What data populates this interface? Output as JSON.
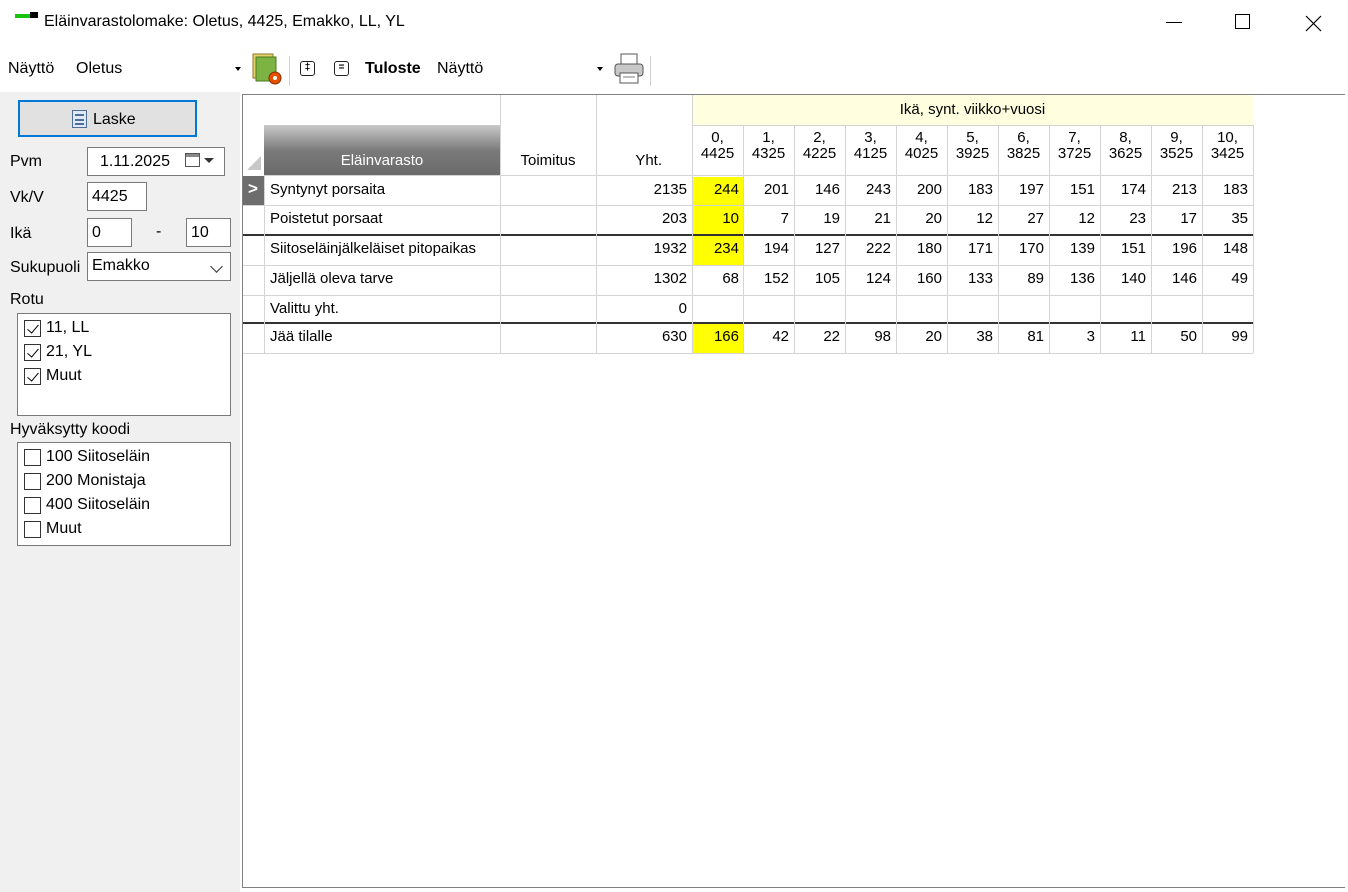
{
  "window": {
    "title": "Eläinvarastolomake: Oletus, 4425, Emakko, LL, YL"
  },
  "toolbar": {
    "display_label": "Näyttö",
    "display_value": "Oletus",
    "print_label": "Tuloste",
    "print_value": "Näyttö",
    "expand_symbol": "‡",
    "collapse_symbol": "="
  },
  "left": {
    "calc_button": "Laske",
    "date_label": "Pvm",
    "date_value": "1.11.2025",
    "week_label": "Vk/V",
    "week_value": "4425",
    "age_label": "Ikä",
    "age_from": "0",
    "age_dash": "-",
    "age_to": "10",
    "sex_label": "Sukupuoli",
    "sex_value": "Emakko",
    "breed_label": "Rotu",
    "breeds": [
      {
        "label": "11, LL",
        "checked": true
      },
      {
        "label": "21, YL",
        "checked": true
      },
      {
        "label": "Muut",
        "checked": true
      }
    ],
    "code_label": "Hyväksytty koodi",
    "codes": [
      {
        "label": "100 Siitoseläin",
        "checked": false
      },
      {
        "label": "200 Monistaja",
        "checked": false
      },
      {
        "label": "400 Siitoseläin",
        "checked": false
      },
      {
        "label": "Muut",
        "checked": false
      }
    ]
  },
  "grid": {
    "group_header": "Ikä, synt. viikko+vuosi",
    "col_elain": "Eläinvarasto",
    "col_toimitus": "Toimitus",
    "col_yht": "Yht.",
    "age_cols": [
      {
        "a": "0,",
        "b": "4425"
      },
      {
        "a": "1,",
        "b": "4325"
      },
      {
        "a": "2,",
        "b": "4225"
      },
      {
        "a": "3,",
        "b": "4125"
      },
      {
        "a": "4,",
        "b": "4025"
      },
      {
        "a": "5,",
        "b": "3925"
      },
      {
        "a": "6,",
        "b": "3825"
      },
      {
        "a": "7,",
        "b": "3725"
      },
      {
        "a": "8,",
        "b": "3625"
      },
      {
        "a": "9,",
        "b": "3525"
      },
      {
        "a": "10,",
        "b": "3425"
      }
    ],
    "current_row_marker": ">",
    "highlight_color": "#ffff00",
    "rows": [
      {
        "label": "Syntynyt porsaita",
        "toimitus": "",
        "yht": "2135",
        "vals": [
          "244",
          "201",
          "146",
          "243",
          "200",
          "183",
          "197",
          "151",
          "174",
          "213",
          "183"
        ],
        "highlight": true
      },
      {
        "label": "Poistetut porsaat",
        "toimitus": "",
        "yht": "203",
        "vals": [
          "10",
          "7",
          "19",
          "21",
          "20",
          "12",
          "27",
          "12",
          "23",
          "17",
          "35"
        ],
        "highlight": true
      },
      {
        "label": "Siitoseläinjälkeläiset pitopaikas",
        "toimitus": "",
        "yht": "1932",
        "vals": [
          "234",
          "194",
          "127",
          "222",
          "180",
          "171",
          "170",
          "139",
          "151",
          "196",
          "148"
        ],
        "highlight": true
      },
      {
        "label": "Jäljellä oleva tarve",
        "toimitus": "",
        "yht": "1302",
        "vals": [
          "68",
          "152",
          "105",
          "124",
          "160",
          "133",
          "89",
          "136",
          "140",
          "146",
          "49"
        ],
        "highlight": false
      },
      {
        "label": "Valittu yht.",
        "toimitus": "",
        "yht": "0",
        "vals": [
          "",
          "",
          "",
          "",
          "",
          "",
          "",
          "",
          "",
          "",
          ""
        ],
        "highlight": false
      },
      {
        "label": "Jää tilalle",
        "toimitus": "",
        "yht": "630",
        "vals": [
          "166",
          "42",
          "22",
          "98",
          "20",
          "38",
          "81",
          "3",
          "11",
          "50",
          "99"
        ],
        "highlight": true
      }
    ]
  }
}
